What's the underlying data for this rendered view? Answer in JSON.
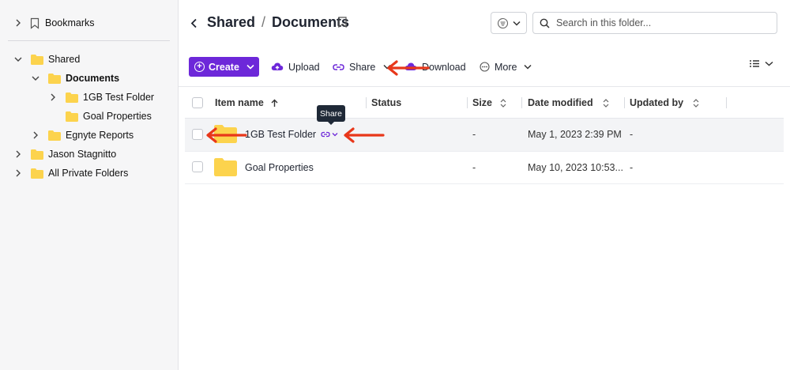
{
  "sidebar": {
    "bookmarks": "Bookmarks",
    "tree": [
      {
        "label": "Shared",
        "bold": false
      },
      {
        "label": "Documents",
        "bold": true
      },
      {
        "label": "1GB Test Folder",
        "bold": false
      },
      {
        "label": "Goal Properties",
        "bold": false
      },
      {
        "label": "Egnyte Reports",
        "bold": false
      },
      {
        "label": "Jason Stagnitto",
        "bold": false
      },
      {
        "label": "All Private Folders",
        "bold": false
      }
    ]
  },
  "header": {
    "breadcrumb": [
      "Shared",
      "Documents"
    ],
    "separator": "/",
    "search_placeholder": "Search in this folder..."
  },
  "toolbar": {
    "create": "Create",
    "upload": "Upload",
    "share": "Share",
    "download": "Download",
    "more": "More"
  },
  "table": {
    "columns": [
      "Item name",
      "Status",
      "Size",
      "Date modified",
      "Updated by"
    ],
    "rows": [
      {
        "name": "1GB Test Folder",
        "status": "",
        "size": "-",
        "date": "May 1, 2023 2:39 PM",
        "updated_by": "-"
      },
      {
        "name": "Goal Properties",
        "status": "",
        "size": "-",
        "date": "May 10, 2023 10:53...",
        "updated_by": "-"
      }
    ]
  },
  "tooltip": "Share",
  "colors": {
    "accent": "#6d28d9",
    "folder": "#fcd34d",
    "annotation_arrow": "#e8371a"
  },
  "icons": [
    "chevron-left-icon",
    "bookmark-icon",
    "search-icon",
    "link-icon",
    "upload-cloud-icon",
    "download-cloud-icon",
    "more-circle-icon",
    "list-view-icon",
    "sort-up-icon",
    "sort-updown-icon",
    "folder-icon"
  ]
}
